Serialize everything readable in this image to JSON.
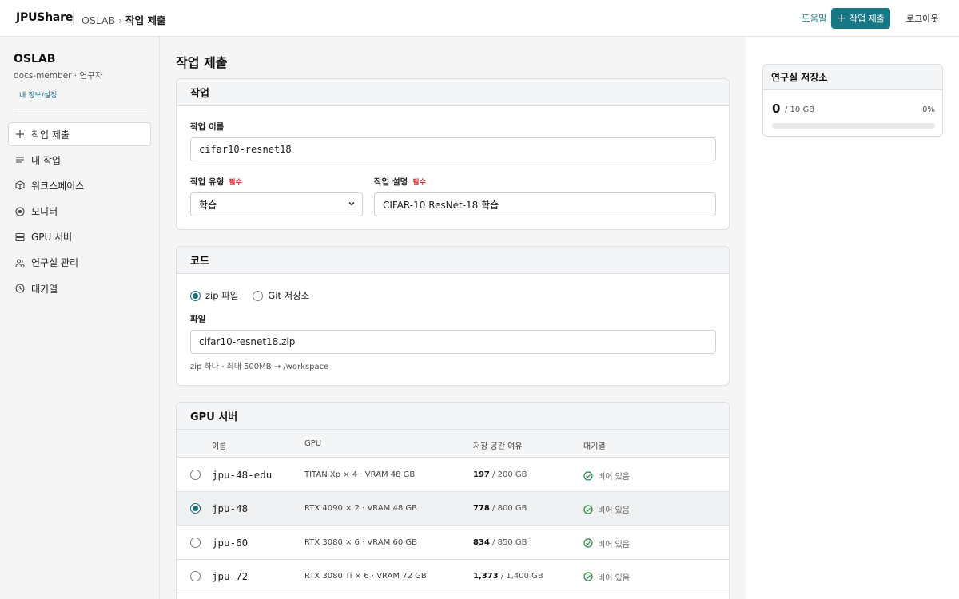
{
  "header": {
    "brand": "JPUShare",
    "breadcrumb_org": "OSLAB",
    "breadcrumb_arrow": "›",
    "breadcrumb_current": "작업 제출",
    "help": "도움말",
    "submit_label": "작업 제출",
    "logout": "로그아웃"
  },
  "sidebar": {
    "org": "OSLAB",
    "sub": "docs-member · 연구자",
    "profile_link": "내 정보/설정",
    "items": [
      {
        "label": "작업 제출",
        "icon": "plus-icon"
      },
      {
        "label": "내 작업",
        "icon": "list-icon"
      },
      {
        "label": "워크스페이스",
        "icon": "cube-icon"
      },
      {
        "label": "모니터",
        "icon": "target-icon"
      },
      {
        "label": "GPU 서버",
        "icon": "server-icon"
      },
      {
        "label": "연구실 관리",
        "icon": "users-icon"
      },
      {
        "label": "대기열",
        "icon": "clock-icon"
      }
    ]
  },
  "main": {
    "title": "작업 제출",
    "job_card": {
      "title": "작업",
      "name_label": "작업 이름",
      "name_value": "cifar10-resnet18",
      "type_label": "작업 유형",
      "type_required": "필수",
      "type_value": "학습",
      "desc_label": "작업 설명",
      "desc_required": "필수",
      "desc_value": "CIFAR-10 ResNet-18 학습"
    },
    "code_card": {
      "title": "코드",
      "option_zip": "zip 파일",
      "option_git": "Git 저장소",
      "file_label": "파일",
      "file_value": "cifar10-resnet18.zip",
      "hint": "zip 하나 · 최대 500MB → /workspace"
    },
    "gpu_card": {
      "title": "GPU 서버",
      "columns": [
        "이름",
        "GPU",
        "저장 공간 여유",
        "대기열"
      ],
      "rows": [
        {
          "name": "jpu-48-edu",
          "gpu": "TITAN Xp × 4 · VRAM 48 GB",
          "free": "197",
          "total": " / 200 GB",
          "queue": "비어 있음",
          "selected": false
        },
        {
          "name": "jpu-48",
          "gpu": "RTX 4090 × 2 · VRAM 48 GB",
          "free": "778",
          "total": " / 800 GB",
          "queue": "비어 있음",
          "selected": true
        },
        {
          "name": "jpu-60",
          "gpu": "RTX 3080 × 6 · VRAM 60 GB",
          "free": "834",
          "total": " / 850 GB",
          "queue": "비어 있음",
          "selected": false
        },
        {
          "name": "jpu-72",
          "gpu": "RTX 3080 Ti × 6 · VRAM 72 GB",
          "free": "1,373",
          "total": " / 1,400 GB",
          "queue": "비어 있음",
          "selected": false
        }
      ]
    }
  },
  "storage": {
    "title": "연구실 저장소",
    "used": "0",
    "total": "/ 10 GB",
    "percent": "0%",
    "fraction": 0.0
  },
  "colors": {
    "accent": "#167884",
    "required": "#d02b2b",
    "success": "#1f8a3a"
  }
}
